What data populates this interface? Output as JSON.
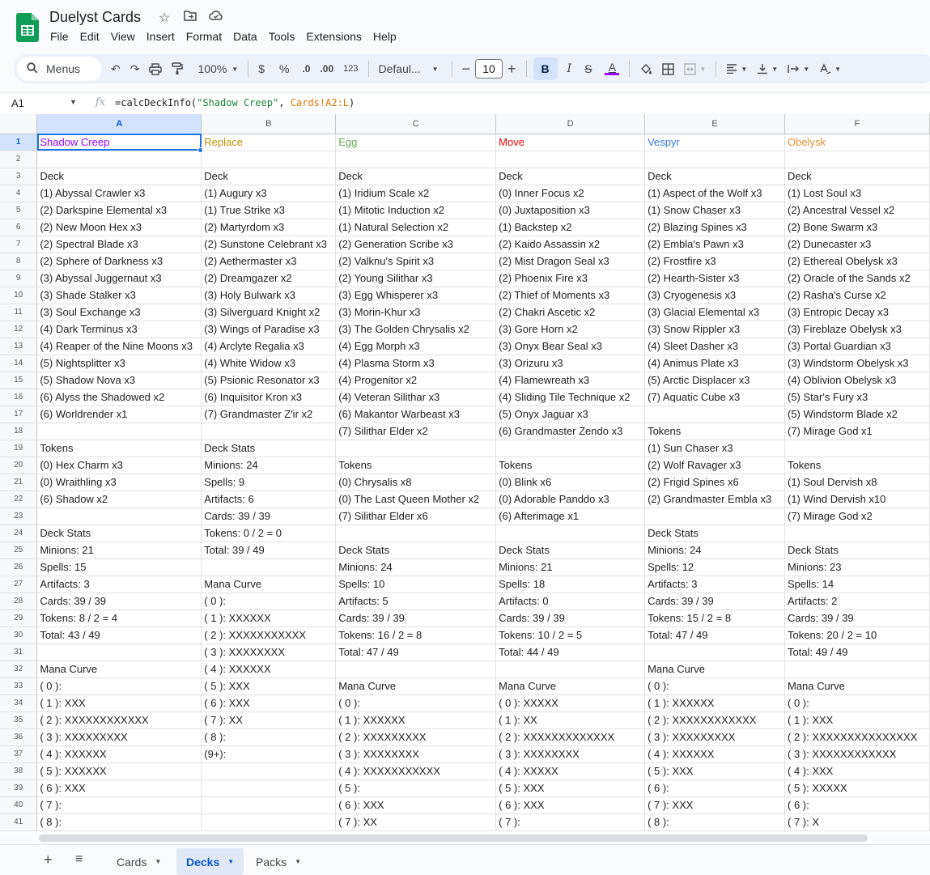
{
  "app": {
    "title": "Duelyst Cards",
    "menu": [
      "File",
      "Edit",
      "View",
      "Insert",
      "Format",
      "Data",
      "Tools",
      "Extensions",
      "Help"
    ]
  },
  "toolbar": {
    "menus_label": "Menus",
    "zoom": "100%",
    "currency": "$",
    "percent": "%",
    "dec_decrease": ".0",
    "dec_increase": ".00",
    "number_format": "123",
    "font": "Defaul...",
    "font_size": "10",
    "bold": "B",
    "italic": "I",
    "strike": "S",
    "text_color": "A"
  },
  "formula_bar": {
    "cell_ref": "A1",
    "fx": "fx",
    "func": "=calcDeckInfo(",
    "arg1": "\"Shadow Creep\"",
    "comma": ", ",
    "arg2": "Cards!A2:L",
    "close": ")"
  },
  "columns": [
    "A",
    "B",
    "C",
    "D",
    "E",
    "F"
  ],
  "header_colors": [
    "#9900ff",
    "#bf9000",
    "#6aa84f",
    "#ff0000",
    "#3c78d8",
    "#e69138"
  ],
  "rows": [
    [
      "Shadow Creep",
      "Replace",
      "Egg",
      "Move",
      "Vespyr",
      "Obelysk"
    ],
    [
      "",
      "",
      "",
      "",
      "",
      ""
    ],
    [
      "Deck",
      "Deck",
      "Deck",
      "Deck",
      "Deck",
      "Deck"
    ],
    [
      "(1) Abyssal Crawler x3",
      "(1) Augury x3",
      "(1) Iridium Scale x2",
      "(0) Inner Focus x2",
      "(1) Aspect of the Wolf x3",
      "(1) Lost Soul x3"
    ],
    [
      "(2) Darkspine Elemental x3",
      "(1) True Strike x3",
      "(1) Mitotic Induction x2",
      "(0) Juxtaposition x3",
      "(1) Snow Chaser x3",
      "(2) Ancestral Vessel x2"
    ],
    [
      "(2) New Moon Hex x3",
      "(2) Martyrdom x3",
      "(1) Natural Selection x2",
      "(1) Backstep x2",
      "(2) Blazing Spines x3",
      "(2) Bone Swarm x3"
    ],
    [
      "(2) Spectral Blade x3",
      "(2) Sunstone Celebrant x3",
      "(2) Generation Scribe x3",
      "(2) Kaido Assassin x2",
      "(2) Embla's Pawn x3",
      "(2) Dunecaster x3"
    ],
    [
      "(2) Sphere of Darkness x3",
      "(2) Aethermaster x3",
      "(2) Valknu's Spirit x3",
      "(2) Mist Dragon Seal x3",
      "(2) Frostfire x3",
      "(2) Ethereal Obelysk x3"
    ],
    [
      "(3) Abyssal Juggernaut x3",
      "(2) Dreamgazer x2",
      "(2) Young Silithar x3",
      "(2) Phoenix Fire x3",
      "(2) Hearth-Sister x3",
      "(2) Oracle of the Sands x2"
    ],
    [
      "(3) Shade Stalker x3",
      "(3) Holy Bulwark x3",
      "(3) Egg Whisperer x3",
      "(2) Thief of Moments x3",
      "(3) Cryogenesis x3",
      "(2) Rasha's Curse x2"
    ],
    [
      "(3) Soul Exchange x3",
      "(3) Silverguard Knight x2",
      "(3) Morin-Khur x3",
      "(2) Chakri Ascetic x2",
      "(3) Glacial Elemental x3",
      "(3) Entropic Decay x3"
    ],
    [
      "(4) Dark Terminus x3",
      "(3) Wings of Paradise x3",
      "(3) The Golden Chrysalis x2",
      "(3) Gore Horn x2",
      "(3) Snow Rippler x3",
      "(3) Fireblaze Obelysk x3"
    ],
    [
      "(4) Reaper of the Nine Moons x3",
      "(4) Arclyte Regalia x3",
      "(4) Egg Morph x3",
      "(3) Onyx Bear Seal x3",
      "(4) Sleet Dasher x3",
      "(3) Portal Guardian x3"
    ],
    [
      "(5) Nightsplitter x3",
      "(4) White Widow x3",
      "(4) Plasma Storm x3",
      "(3) Orizuru x3",
      "(4) Animus Plate x3",
      "(3) Windstorm Obelysk x3"
    ],
    [
      "(5) Shadow Nova x3",
      "(5) Psionic Resonator x3",
      "(4) Progenitor x2",
      "(4) Flamewreath x3",
      "(5) Arctic Displacer x3",
      "(4) Oblivion Obelysk x3"
    ],
    [
      "(6) Alyss the Shadowed x2",
      "(6) Inquisitor Kron x3",
      "(4) Veteran Silithar x3",
      "(4) Sliding Tile Technique x2",
      "(7) Aquatic Cube x3",
      "(5) Star's Fury x3"
    ],
    [
      "(6) Worldrender x1",
      "(7) Grandmaster Z'ir x2",
      "(6) Makantor Warbeast x3",
      "(5) Onyx Jaguar x3",
      "",
      "(5) Windstorm Blade x2"
    ],
    [
      "",
      "",
      "(7) Silithar Elder x2",
      "(6) Grandmaster Zendo x3",
      "Tokens",
      "(7) Mirage God x1"
    ],
    [
      "Tokens",
      "Deck Stats",
      "",
      "",
      "(1) Sun Chaser x3",
      ""
    ],
    [
      "(0) Hex Charm x3",
      "Minions: 24",
      "Tokens",
      "Tokens",
      "(2) Wolf Ravager x3",
      "Tokens"
    ],
    [
      "(0) Wraithling x3",
      "Spells: 9",
      "(0) Chrysalis x8",
      "(0) Blink x6",
      "(2) Frigid Spines x6",
      "(1) Soul Dervish x8"
    ],
    [
      "(6) Shadow x2",
      "Artifacts: 6",
      "(0) The Last Queen Mother x2",
      "(0) Adorable Panddo x3",
      "(2) Grandmaster Embla x3",
      "(1) Wind Dervish x10"
    ],
    [
      "",
      "Cards: 39 / 39",
      "(7) Silithar Elder x6",
      "(6) Afterimage x1",
      "",
      "(7) Mirage God x2"
    ],
    [
      "Deck Stats",
      "Tokens: 0 / 2 = 0",
      "",
      "",
      "Deck Stats",
      ""
    ],
    [
      "Minions: 21",
      "Total: 39 / 49",
      "Deck Stats",
      "Deck Stats",
      "Minions: 24",
      "Deck Stats"
    ],
    [
      "Spells: 15",
      "",
      "Minions: 24",
      "Minions: 21",
      "Spells: 12",
      "Minions: 23"
    ],
    [
      "Artifacts: 3",
      "Mana Curve",
      "Spells: 10",
      "Spells: 18",
      "Artifacts: 3",
      "Spells: 14"
    ],
    [
      "Cards: 39 / 39",
      "( 0 ):",
      "Artifacts: 5",
      "Artifacts: 0",
      "Cards: 39 / 39",
      "Artifacts: 2"
    ],
    [
      "Tokens: 8 / 2 = 4",
      "( 1 ): XXXXXX",
      "Cards: 39 / 39",
      "Cards: 39 / 39",
      "Tokens: 15 / 2 = 8",
      "Cards: 39 / 39"
    ],
    [
      "Total: 43 / 49",
      "( 2 ): XXXXXXXXXXX",
      "Tokens: 16 / 2 = 8",
      "Tokens: 10 / 2 = 5",
      "Total: 47 / 49",
      "Tokens: 20 / 2 = 10"
    ],
    [
      "",
      "( 3 ): XXXXXXXX",
      "Total: 47 / 49",
      "Total: 44 / 49",
      "",
      "Total: 49 / 49"
    ],
    [
      "Mana Curve",
      "( 4 ): XXXXXX",
      "",
      "",
      "Mana Curve",
      ""
    ],
    [
      "( 0 ):",
      "( 5 ): XXX",
      "Mana Curve",
      "Mana Curve",
      "( 0 ):",
      "Mana Curve"
    ],
    [
      "( 1 ): XXX",
      "( 6 ): XXX",
      "( 0 ):",
      "( 0 ): XXXXX",
      "( 1 ): XXXXXX",
      "( 0 ):"
    ],
    [
      "( 2 ): XXXXXXXXXXXX",
      "( 7 ): XX",
      "( 1 ): XXXXXX",
      "( 1 ): XX",
      "( 2 ): XXXXXXXXXXXX",
      "( 1 ): XXX"
    ],
    [
      "( 3 ): XXXXXXXXX",
      "( 8 ):",
      "( 2 ): XXXXXXXXX",
      "( 2 ): XXXXXXXXXXXXX",
      "( 3 ): XXXXXXXXX",
      "( 2 ): XXXXXXXXXXXXXXX"
    ],
    [
      "( 4 ): XXXXXX",
      "(9+):",
      "( 3 ): XXXXXXXX",
      "( 3 ): XXXXXXXX",
      "( 4 ): XXXXXX",
      "( 3 ): XXXXXXXXXXXX"
    ],
    [
      "( 5 ): XXXXXX",
      "",
      "( 4 ): XXXXXXXXXXX",
      "( 4 ): XXXXX",
      "( 5 ): XXX",
      "( 4 ): XXX"
    ],
    [
      "( 6 ): XXX",
      "",
      "( 5 ):",
      "( 5 ): XXX",
      "( 6 ):",
      "( 5 ): XXXXX"
    ],
    [
      "( 7 ):",
      "",
      "( 6 ): XXX",
      "( 6 ): XXX",
      "( 7 ): XXX",
      "( 6 ):"
    ],
    [
      "( 8 ):",
      "",
      "( 7 ): XX",
      "( 7 ):",
      "( 8 ):",
      "( 7 ): X"
    ]
  ],
  "bold_labels": [
    "Deck",
    "Tokens",
    "Deck Stats",
    "Mana Curve"
  ],
  "sheets": {
    "add": "+",
    "list": "≡",
    "tabs": [
      "Cards",
      "Decks",
      "Packs"
    ],
    "active": "Decks"
  }
}
